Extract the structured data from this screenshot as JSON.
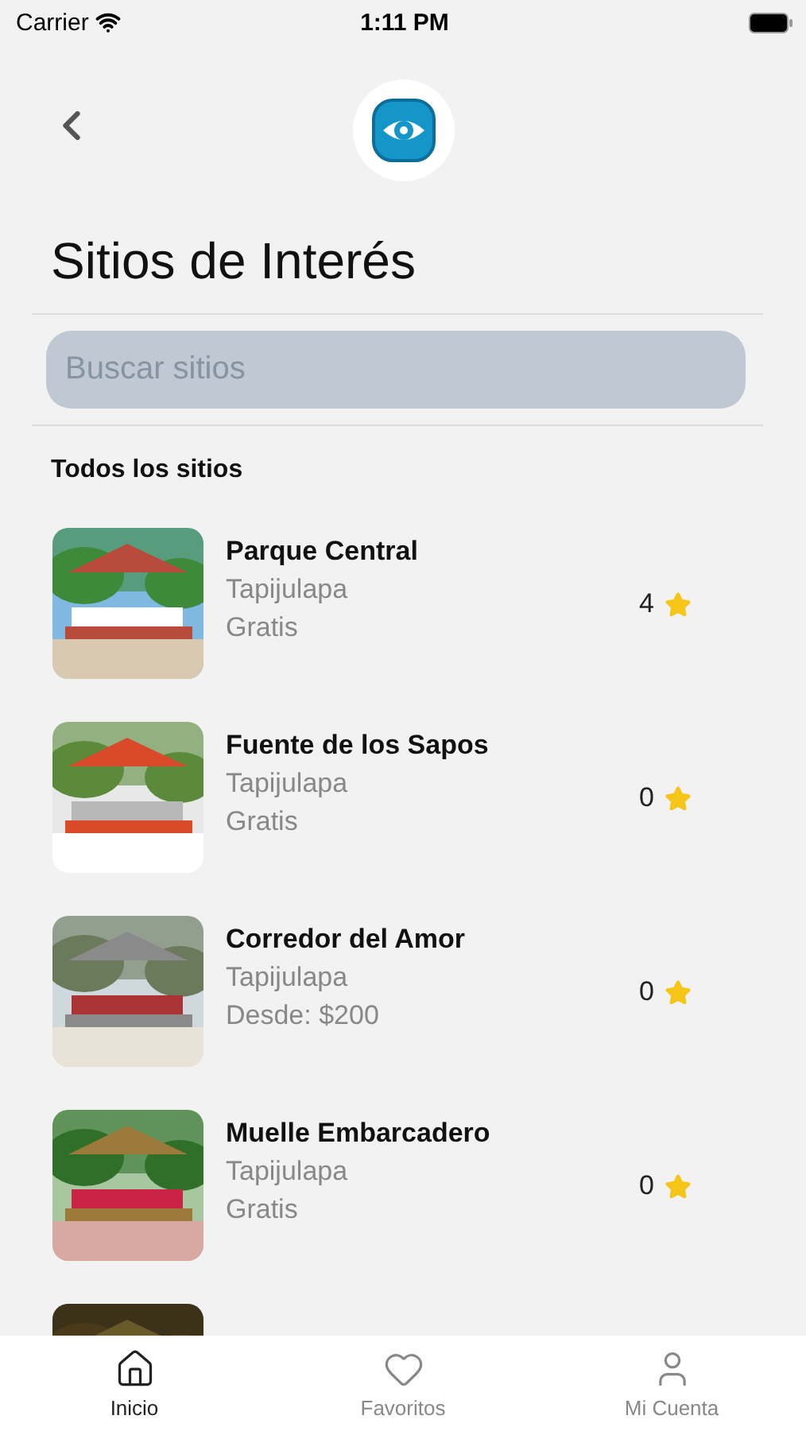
{
  "status_bar": {
    "carrier": "Carrier",
    "time": "1:11 PM"
  },
  "title": "Sitios de Interés",
  "search": {
    "placeholder": "Buscar sitios"
  },
  "section_title": "Todos los sitios",
  "sites": [
    {
      "name": "Parque Central",
      "town": "Tapijulapa",
      "price": "Gratis",
      "rating": "4",
      "kind": "gazebo"
    },
    {
      "name": "Fuente de los Sapos",
      "town": "Tapijulapa",
      "price": "Gratis",
      "rating": "0",
      "kind": "fountain"
    },
    {
      "name": "Corredor del Amor",
      "town": "Tapijulapa",
      "price": "Desde: $200",
      "rating": "0",
      "kind": "street"
    },
    {
      "name": "Muelle Embarcadero",
      "town": "Tapijulapa",
      "price": "Gratis",
      "rating": "0",
      "kind": "river"
    },
    {
      "kind": "night"
    }
  ],
  "tabs": [
    {
      "label": "Inicio",
      "kind": "home",
      "selected": true
    },
    {
      "label": "Favoritos",
      "kind": "heart",
      "selected": false
    },
    {
      "label": "Mi Cuenta",
      "kind": "user",
      "selected": false
    }
  ]
}
